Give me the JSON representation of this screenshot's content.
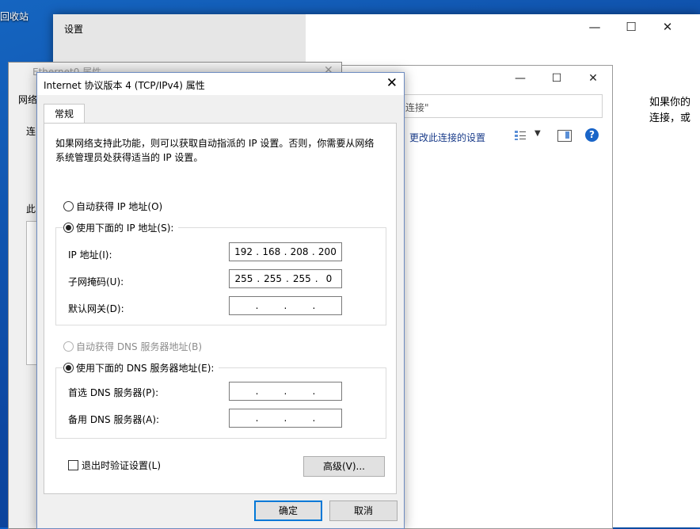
{
  "desktop": {
    "recycle_bin_label": "回收站"
  },
  "settings_window": {
    "title": "设置",
    "right_text_line1": "如果你的",
    "right_text_line2": "连接，或"
  },
  "network_connections": {
    "search_partial": "连接\"",
    "toolbar_change_settings": "更改此连接的设置"
  },
  "ethernet_props": {
    "title": "Ethernet0 属性",
    "tab_partial": "网络",
    "label_partial_conn": "连",
    "label_partial_this": "此"
  },
  "ipv4_dialog": {
    "title": "Internet 协议版本 4 (TCP/IPv4) 属性",
    "tab_general": "常规",
    "description": "如果网络支持此功能，则可以获取自动指派的 IP 设置。否则，你需要从网络系统管理员处获得适当的 IP 设置。",
    "auto_ip_label": "自动获得 IP 地址(O)",
    "manual_ip_label": "使用下面的 IP 地址(S):",
    "ip_address_label": "IP 地址(I):",
    "ip_address": [
      "192",
      "168",
      "208",
      "200"
    ],
    "subnet_label": "子网掩码(U):",
    "subnet_mask": [
      "255",
      "255",
      "255",
      "0"
    ],
    "gateway_label": "默认网关(D):",
    "gateway": [
      "",
      "",
      "",
      ""
    ],
    "auto_dns_label": "自动获得 DNS 服务器地址(B)",
    "manual_dns_label": "使用下面的 DNS 服务器地址(E):",
    "preferred_dns_label": "首选 DNS 服务器(P):",
    "preferred_dns": [
      "",
      "",
      "",
      ""
    ],
    "alternate_dns_label": "备用 DNS 服务器(A):",
    "alternate_dns": [
      "",
      "",
      "",
      ""
    ],
    "validate_on_exit_label": "退出时验证设置(L)",
    "advanced_button": "高级(V)...",
    "ok_button": "确定",
    "cancel_button": "取消"
  },
  "colors": {
    "accent": "#0078d7",
    "desktop_blue": "#0d47a1",
    "link_text": "#1a3c8a"
  }
}
